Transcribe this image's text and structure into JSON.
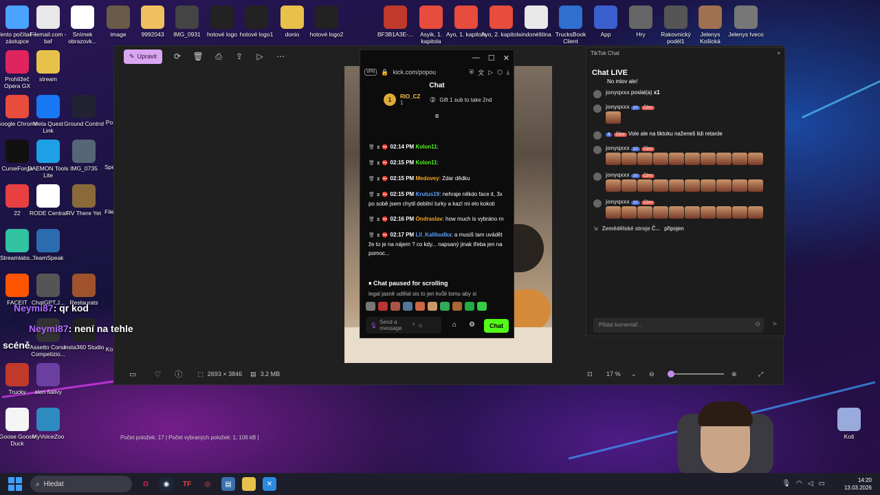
{
  "desktop_icons": [
    {
      "label": "Tento počítač – zástupce",
      "icon": "computer-icon",
      "color": "#4aa3ff"
    },
    {
      "label": "Filemail.com - baf",
      "icon": "7z-icon",
      "color": "#e8e8e8"
    },
    {
      "label": "Snímek obrazovk...",
      "icon": "qr-icon",
      "color": "#ffffff"
    },
    {
      "label": "image",
      "icon": "photo-icon",
      "color": "#6a5a4a"
    },
    {
      "label": "9992043",
      "icon": "photo-icon",
      "color": "#f0c060"
    },
    {
      "label": "IMG_0931",
      "icon": "photo-icon",
      "color": "#444"
    },
    {
      "label": "hotové logo",
      "icon": "logo-icon",
      "color": "#222"
    },
    {
      "label": "hotové logo1",
      "icon": "logo-icon",
      "color": "#222"
    },
    {
      "label": "donio",
      "icon": "folder-icon",
      "color": "#e8c14a"
    },
    {
      "label": "hotové logo2",
      "icon": "logo-icon",
      "color": "#222"
    },
    {
      "label": "BF3B1A3E-...",
      "icon": "photo-icon",
      "color": "#c0392b"
    },
    {
      "label": "Asyik, 1. kapitola",
      "icon": "chrome-icon",
      "color": "#e74c3c"
    },
    {
      "label": "Ayo, 1. kapitola",
      "icon": "chrome-icon",
      "color": "#e74c3c"
    },
    {
      "label": "Ayo, 2. kapitola",
      "icon": "chrome-icon",
      "color": "#e74c3c"
    },
    {
      "label": "indonéština",
      "icon": "7z-icon",
      "color": "#e8e8e8"
    },
    {
      "label": "TrucksBook Client",
      "icon": "app-icon",
      "color": "#2f6fd0"
    },
    {
      "label": "App",
      "icon": "app-icon",
      "color": "#3a5fcf"
    },
    {
      "label": "Hry",
      "icon": "folder-icon",
      "color": "#666"
    },
    {
      "label": "Rakovnický podél1",
      "icon": "photo-icon",
      "color": "#555"
    },
    {
      "label": "Jelenys Košická",
      "icon": "photo-icon",
      "color": "#a07050"
    },
    {
      "label": "Jelenys Iveco",
      "icon": "photo-icon",
      "color": "#777"
    },
    {
      "label": "Prohlížeč Opera GX",
      "icon": "opera-icon",
      "color": "#e0245e"
    },
    {
      "label": "stream",
      "icon": "folder-icon",
      "color": "#e8c14a"
    },
    {
      "label": "Google Chrome",
      "icon": "chrome-icon",
      "color": "#e74c3c"
    },
    {
      "label": "Meta Quest Link",
      "icon": "meta-icon",
      "color": "#1877f2"
    },
    {
      "label": "Ground Control",
      "icon": "app-icon",
      "color": "#223"
    },
    {
      "label": "CurseForge",
      "icon": "app-icon",
      "color": "#111"
    },
    {
      "label": "DAEMON Tools Lite",
      "icon": "app-icon",
      "color": "#1ea0e6"
    },
    {
      "label": "IMG_0735",
      "icon": "photo-icon",
      "color": "#567"
    },
    {
      "label": "22",
      "icon": "app-icon",
      "color": "#e84040"
    },
    {
      "label": "RODE Central",
      "icon": "app-icon",
      "color": "#fff"
    },
    {
      "label": "RV There Yet",
      "icon": "app-icon",
      "color": "#8a6a3a"
    },
    {
      "label": "Streamlabs...",
      "icon": "app-icon",
      "color": "#31c3a2"
    },
    {
      "label": "TeamSpeak",
      "icon": "app-icon",
      "color": "#2b6cb0"
    },
    {
      "label": "FACEIT",
      "icon": "app-icon",
      "color": "#ff5500"
    },
    {
      "label": "ChatGPT,J...",
      "icon": "app-icon",
      "color": "#555"
    },
    {
      "label": "Restaurats",
      "icon": "app-icon",
      "color": "#a0522d"
    },
    {
      "label": "Assetto Corsa Competizio...",
      "icon": "app-icon",
      "color": "#333"
    },
    {
      "label": "Insta360 Studio",
      "icon": "app-icon",
      "color": "#222"
    },
    {
      "label": "Trucky",
      "icon": "app-icon",
      "color": "#c0392b"
    },
    {
      "label": "alen fialivy",
      "icon": "app-icon",
      "color": "#6a3fa0"
    },
    {
      "label": "Goose Goose Duck",
      "icon": "app-icon",
      "color": "#f5f5f5"
    },
    {
      "label": "MyVoiceZoo",
      "icon": "app-icon",
      "color": "#2e8bc0"
    },
    {
      "label": "Koš",
      "icon": "recycle-bin-icon",
      "color": "#9ad"
    }
  ],
  "desktop_partial": {
    "po": "Po",
    "sp": "Spe",
    "file": "File",
    "ko": "Ko"
  },
  "viewer": {
    "edit_label": "Upravit",
    "dimensions": "2693 × 3846",
    "size": "3.2 MB",
    "zoom": "17 %",
    "zoom_fraction": 0.17
  },
  "kick": {
    "url": "kick.com/popou",
    "vpn": "VPN",
    "title": "Chat",
    "pinned_user": "RIO_CZ",
    "pinned_rank": "1",
    "pinned_count": "1",
    "gift_text": "Gift 1 sub to take 2nd",
    "messages": [
      {
        "time": "02:14 PM",
        "user": "Kolon11",
        "color": "#53fc18",
        "text": ""
      },
      {
        "time": "02:15 PM",
        "user": "Kolon11",
        "color": "#53fc18",
        "text": ""
      },
      {
        "time": "02:15 PM",
        "user": "Medovey",
        "color": "#f5a623",
        "text": "Zdar dědku"
      },
      {
        "time": "02:15 PM",
        "user": "Krutus19",
        "color": "#5ba3ff",
        "text": "nehraje někdo face it, 3x po sobě jsem chytil debilní turky a kazí mi elo kokoti"
      },
      {
        "time": "02:16 PM",
        "user": "Ondraslav",
        "color": "#f5a623",
        "text": "how much is vybráno rn"
      },
      {
        "time": "02:17 PM",
        "user": "Lil_Kalibudka",
        "color": "#5ba3ff",
        "text": "a musíš tam uvádět že to je na nájem ? co kdy... napsaný jinak třeba jen na pomoc..."
      }
    ],
    "paused_text": "Chat paused for scrolling",
    "paused_sub": "legal jasně udělal sis to jen kvůli tomu aby si",
    "input_placeholder": "Send a message",
    "chat_button": "Chat"
  },
  "tiktok": {
    "window_title": "TikTok Chat",
    "header": "Chat LIVE",
    "top_cut": "No mlov ale!",
    "rows": [
      {
        "user": "jonyqxxx",
        "text": "poslal(a)",
        "suffix": "x1",
        "lvl": "",
        "fan": ""
      },
      {
        "user": "jonyqxxx",
        "text": "",
        "suffix": "",
        "lvl": "10",
        "fan": "Čůro"
      },
      {
        "user": "",
        "text": "Vole ale na tiktoku naženeš lidi retarde",
        "suffix": "",
        "lvl": "9",
        "fan": "Čůro"
      },
      {
        "user": "jonyqxxx",
        "text": "",
        "suffix": "",
        "lvl": "10",
        "fan": "Čůro"
      },
      {
        "user": "jonyqxxx",
        "text": "",
        "suffix": "",
        "lvl": "10",
        "fan": "Čůro"
      },
      {
        "user": "jonyqxxx",
        "text": "",
        "suffix": "",
        "lvl": "10",
        "fan": "Čůro"
      }
    ],
    "joined_user": "Zemědělské stroje Č...",
    "joined_text": "připojen",
    "input_placeholder": "Přidat komentář..."
  },
  "overlay": {
    "line1_user": "Neymi87",
    "line1_text": ": qr kod",
    "line2_user": "Neymi87",
    "line2_text": ": není na tehle",
    "line3_text": "scéně"
  },
  "explorer_status": {
    "items": "Počet položek: 17",
    "selected": "Počet vybraných položek: 1; 106 kB"
  },
  "taskbar": {
    "search_placeholder": "Hledat",
    "time": "14:20",
    "date": "13.03.2026"
  }
}
